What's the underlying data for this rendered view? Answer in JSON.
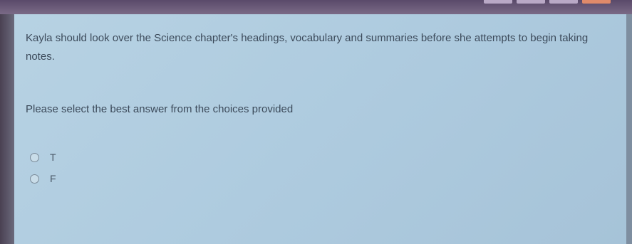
{
  "question": {
    "text": "Kayla should look over the Science chapter's headings, vocabulary and summaries before she attempts to begin taking notes."
  },
  "instruction": "Please select the best answer from the choices provided",
  "choices": [
    {
      "label": "T"
    },
    {
      "label": "F"
    }
  ],
  "colors": {
    "panel": "#aecbdf",
    "text": "#3c4a5a",
    "background": "#6b5a78"
  }
}
